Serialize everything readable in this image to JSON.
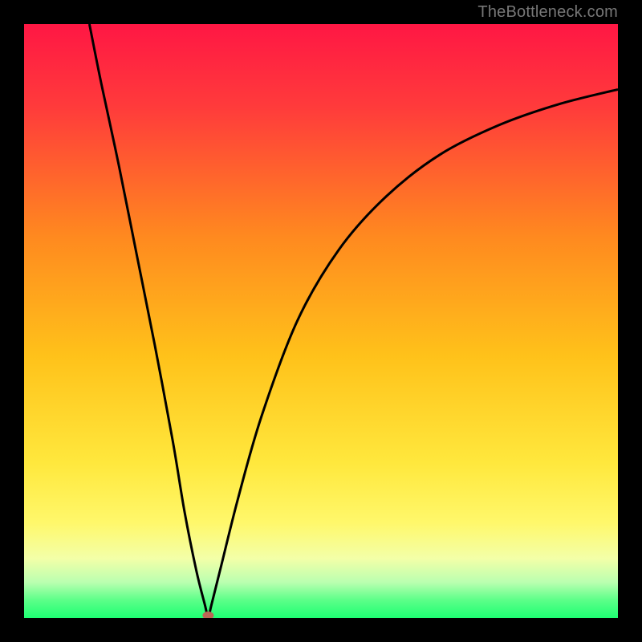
{
  "watermark": "TheBottleneck.com",
  "chart_data": {
    "type": "line",
    "title": "",
    "xlabel": "",
    "ylabel": "",
    "xlim": [
      0,
      100
    ],
    "ylim": [
      0,
      100
    ],
    "grid": false,
    "legend": false,
    "annotations": [],
    "curve_min_x": 31,
    "curve_min_y": 0,
    "gradient_stops": [
      {
        "pct": 0,
        "color": "#ff1744"
      },
      {
        "pct": 14,
        "color": "#ff3b3b"
      },
      {
        "pct": 36,
        "color": "#ff8a1f"
      },
      {
        "pct": 56,
        "color": "#ffc21a"
      },
      {
        "pct": 74,
        "color": "#ffe83d"
      },
      {
        "pct": 84,
        "color": "#fff86b"
      },
      {
        "pct": 90,
        "color": "#f3ffa8"
      },
      {
        "pct": 94,
        "color": "#baffb0"
      },
      {
        "pct": 97,
        "color": "#5cff89"
      },
      {
        "pct": 100,
        "color": "#1eff73"
      }
    ],
    "series": [
      {
        "name": "bottleneck-curve",
        "x": [
          11,
          13,
          16,
          19,
          22,
          25,
          27,
          29,
          30.5,
          31,
          31.5,
          33,
          36,
          40,
          46,
          53,
          61,
          70,
          80,
          90,
          100
        ],
        "y": [
          100,
          90,
          76,
          61,
          46,
          30,
          18,
          8,
          2,
          0,
          2,
          8,
          20,
          34,
          50,
          62,
          71,
          78,
          83,
          86.5,
          89
        ]
      }
    ],
    "marker": {
      "x": 31,
      "y": 0,
      "color": "#bb6655"
    }
  }
}
